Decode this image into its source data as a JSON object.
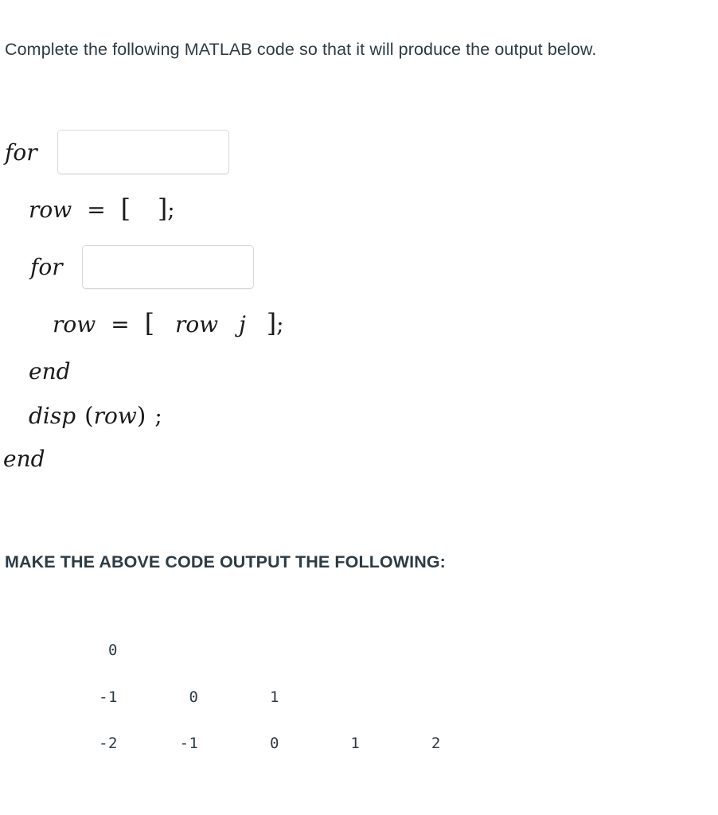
{
  "prompt": {
    "text": "Complete the following MATLAB code so that it will produce the output below."
  },
  "code": {
    "lines": [
      {
        "id": "for-outer",
        "keyword": "for",
        "has_input": true,
        "input_value": "",
        "input_placeholder": ""
      },
      {
        "id": "row-init",
        "variable": "row",
        "equals": "=",
        "open_bracket": "[",
        "contents": "",
        "close_bracket": "]",
        "semicolon": ";"
      },
      {
        "id": "for-inner",
        "keyword": "for",
        "has_input": true,
        "input_value": "",
        "input_placeholder": ""
      },
      {
        "id": "row-append",
        "variable": "row",
        "equals": "=",
        "open_bracket": "[",
        "arg1": "row",
        "arg2": "j",
        "close_bracket": "]",
        "semicolon": ";"
      },
      {
        "id": "end-inner",
        "keyword": "end"
      },
      {
        "id": "disp-row",
        "fname": "disp",
        "open_paren": "(",
        "arg": "row",
        "close_paren": ")",
        "semicolon": ";"
      },
      {
        "id": "end-outer",
        "keyword": "end"
      }
    ]
  },
  "make_heading": {
    "text": "MAKE THE ABOVE CODE OUTPUT THE FOLLOWING:"
  },
  "output": {
    "rows": [
      [
        "0"
      ],
      [
        "-1",
        "0",
        "1"
      ],
      [
        "-2",
        "-1",
        "0",
        "1",
        "2"
      ]
    ]
  },
  "colors": {
    "text": "#2d3b45",
    "code": "#1a1a1a",
    "input_border": "#d8d8d8",
    "background": "#ffffff"
  }
}
